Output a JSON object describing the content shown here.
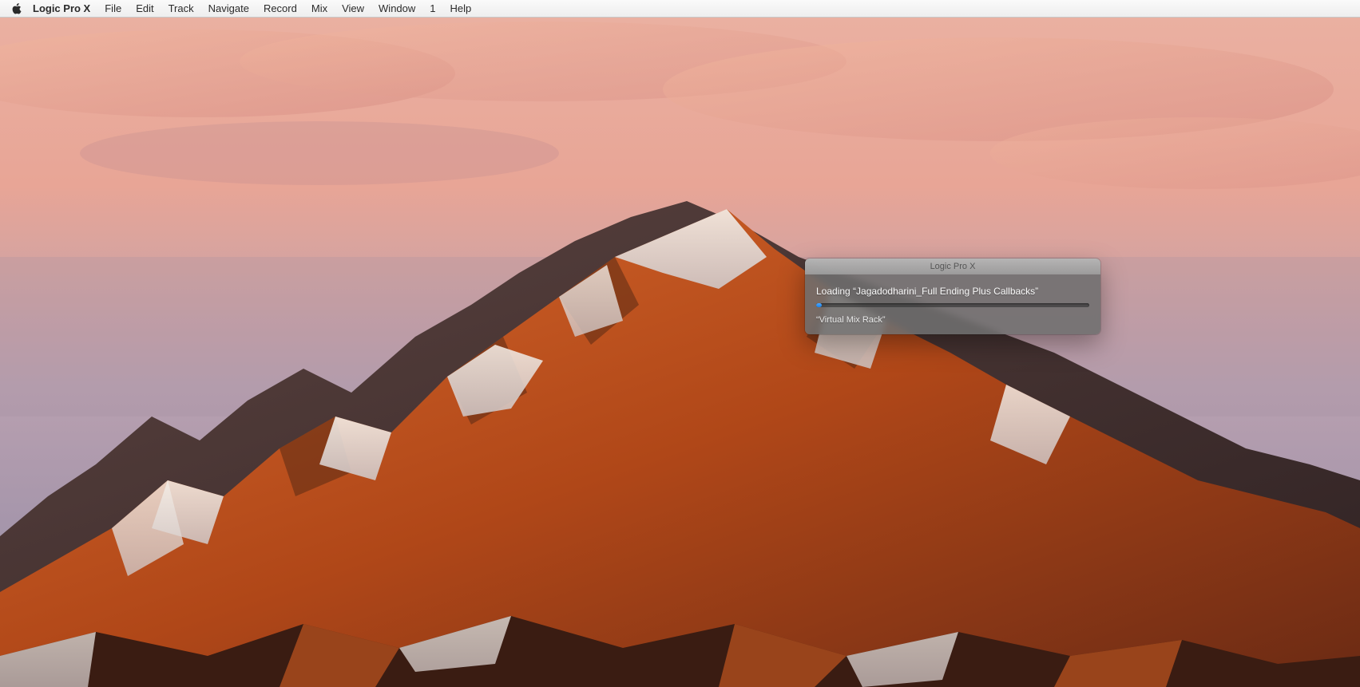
{
  "menubar": {
    "app_name": "Logic Pro X",
    "items": [
      "File",
      "Edit",
      "Track",
      "Navigate",
      "Record",
      "Mix",
      "View",
      "Window",
      "1",
      "Help"
    ]
  },
  "dialog": {
    "title": "Logic Pro X",
    "loading_text": "Loading “Jagadodharini_Full Ending Plus Callbacks”",
    "status_text": "“Virtual Mix Rack”",
    "progress_percent": 2
  }
}
